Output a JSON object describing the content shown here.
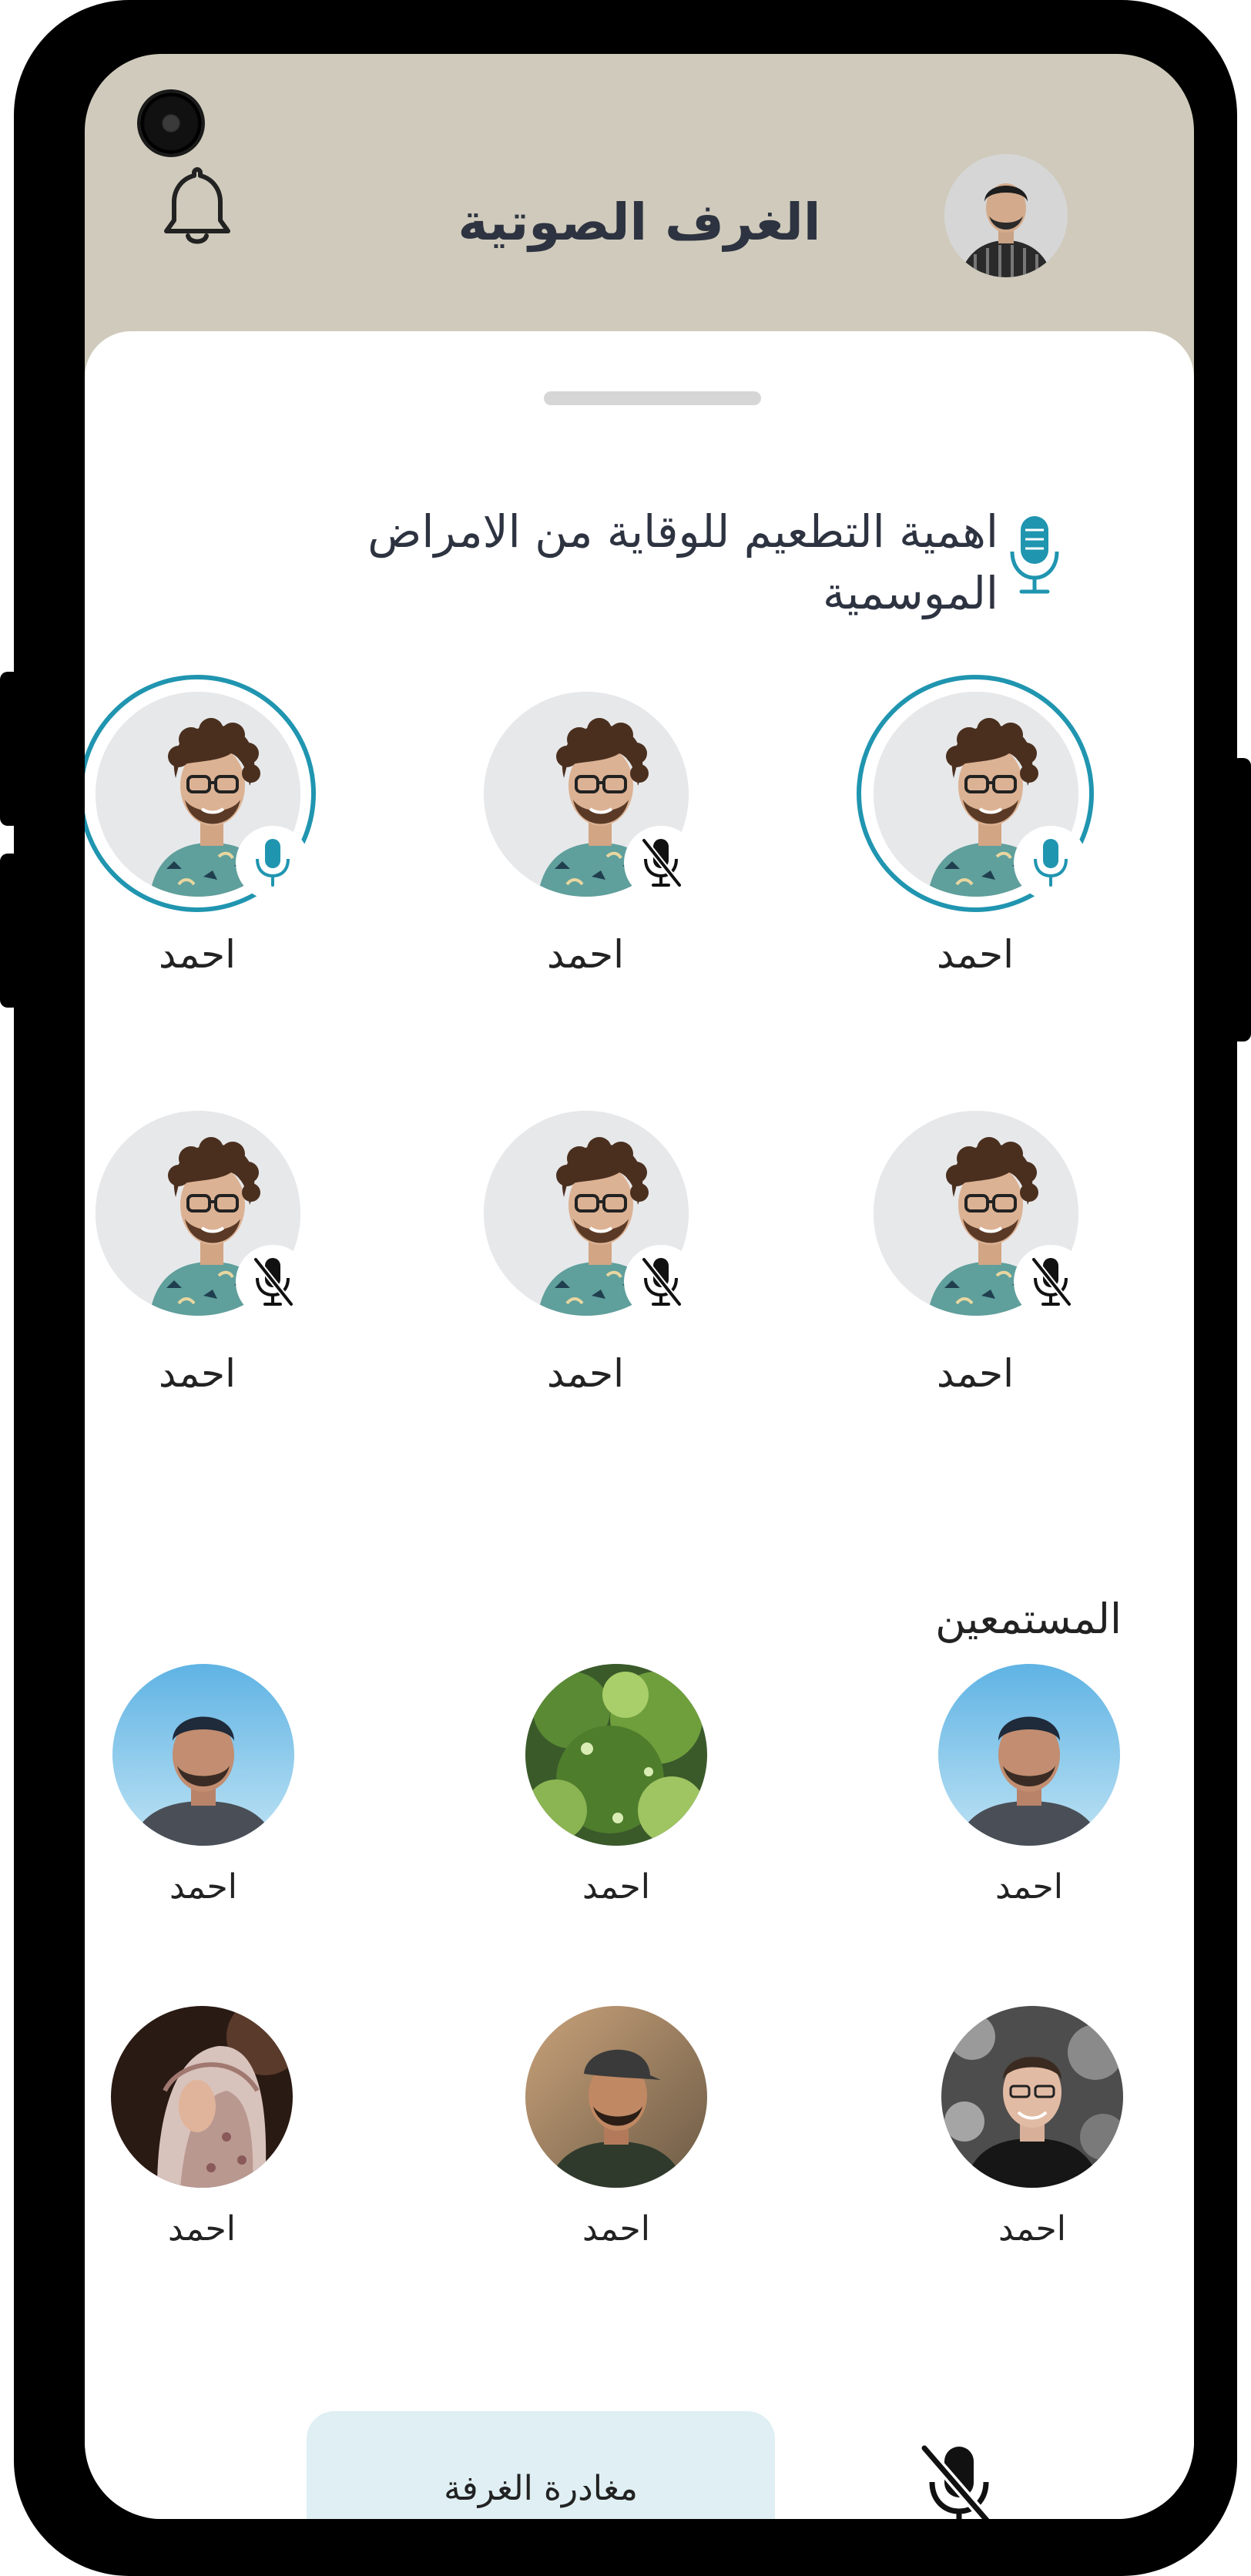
{
  "header": {
    "title": "الغرف الصوتية",
    "notifications_icon": "bell-icon",
    "profile_icon": "user-avatar"
  },
  "room": {
    "topic": "اهمية التطعيم للوقاية من الامراض الموسمية",
    "topic_icon": "microphone-icon",
    "accent_color": "#2095b0"
  },
  "speakers": [
    {
      "name": "احمد",
      "mic": "on",
      "speaking": true
    },
    {
      "name": "احمد",
      "mic": "off",
      "speaking": false
    },
    {
      "name": "احمد",
      "mic": "on",
      "speaking": true
    },
    {
      "name": "احمد",
      "mic": "off",
      "speaking": false
    },
    {
      "name": "احمد",
      "mic": "off",
      "speaking": false
    },
    {
      "name": "احمد",
      "mic": "off",
      "speaking": false
    }
  ],
  "listeners_title": "المستمعين",
  "listeners": [
    {
      "name": "احمد"
    },
    {
      "name": "احمد"
    },
    {
      "name": "احمد"
    },
    {
      "name": "احمد"
    },
    {
      "name": "احمد"
    },
    {
      "name": "احمد"
    }
  ],
  "footer": {
    "leave_label": "مغادرة الغرفة",
    "mute_icon": "mic-off-icon"
  }
}
